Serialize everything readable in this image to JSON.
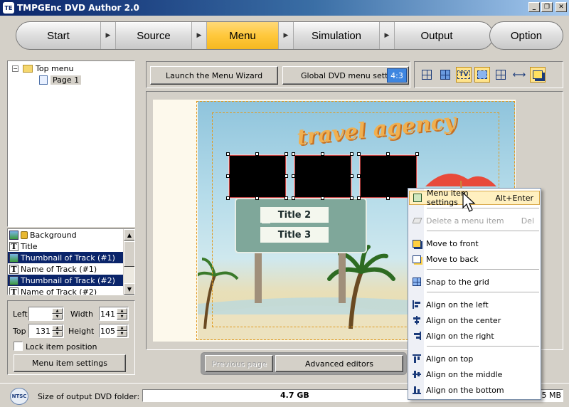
{
  "window": {
    "title": "TMPGEnc DVD Author 2.0",
    "icon_text": "TE"
  },
  "steps": [
    {
      "label": "Start"
    },
    {
      "label": "Source"
    },
    {
      "label": "Menu",
      "active": true
    },
    {
      "label": "Simulation"
    },
    {
      "label": "Output"
    }
  ],
  "option_label": "Option",
  "tree": {
    "root": "Top menu",
    "child": "Page 1"
  },
  "items": [
    {
      "label": "Background",
      "icon": "image-icon",
      "locked": true,
      "selected": false
    },
    {
      "label": "Title",
      "icon": "text-icon",
      "selected": false
    },
    {
      "label": "Thumbnail of Track (#1)",
      "icon": "image-icon",
      "selected": true
    },
    {
      "label": "Name of Track (#1)",
      "icon": "text-icon",
      "selected": false
    },
    {
      "label": "Thumbnail of Track (#2)",
      "icon": "image-icon",
      "selected": true
    },
    {
      "label": "Name of Track (#2)",
      "icon": "text-icon",
      "selected": false
    }
  ],
  "position": {
    "left_label": "Left",
    "left_value": "",
    "width_label": "Width",
    "width_value": "141",
    "top_label": "Top",
    "top_value": "131",
    "height_label": "Height",
    "height_value": "105",
    "lock_label": "Lock item position",
    "settings_button": "Menu item settings"
  },
  "toolbar": {
    "wizard_button": "Launch the Menu Wizard",
    "global_button": "Global DVD menu settings",
    "aspect": "4:3"
  },
  "preview": {
    "banner": "travel agency",
    "title_plates": [
      "Title 2",
      "Title 3"
    ]
  },
  "context_menu": [
    {
      "label": "Menu item settings",
      "shortcut": "Alt+Enter",
      "icon": "edit-icon",
      "highlighted": true
    },
    {
      "label": "Delete a menu item",
      "shortcut": "Del",
      "icon": "eraser-icon",
      "disabled": true
    },
    {
      "label": "Move to front",
      "icon": "bring-front-icon"
    },
    {
      "label": "Move to back",
      "icon": "send-back-icon"
    },
    {
      "label": "Snap to the grid",
      "icon": "grid-icon"
    },
    {
      "label": "Align on the left",
      "icon": "align-left-icon"
    },
    {
      "label": "Align on the center",
      "icon": "align-center-icon"
    },
    {
      "label": "Align on the right",
      "icon": "align-right-icon"
    },
    {
      "label": "Align on top",
      "icon": "align-top-icon"
    },
    {
      "label": "Align on the middle",
      "icon": "align-middle-icon"
    },
    {
      "label": "Align on the bottom",
      "icon": "align-bottom-icon"
    }
  ],
  "bottom": {
    "previous_page": "Previous page",
    "advanced_editors": "Advanced editors"
  },
  "status": {
    "format": "NTSC",
    "size_label": "Size of output DVD folder:",
    "size_value": "4.7 GB",
    "used_value": "25 MB"
  }
}
